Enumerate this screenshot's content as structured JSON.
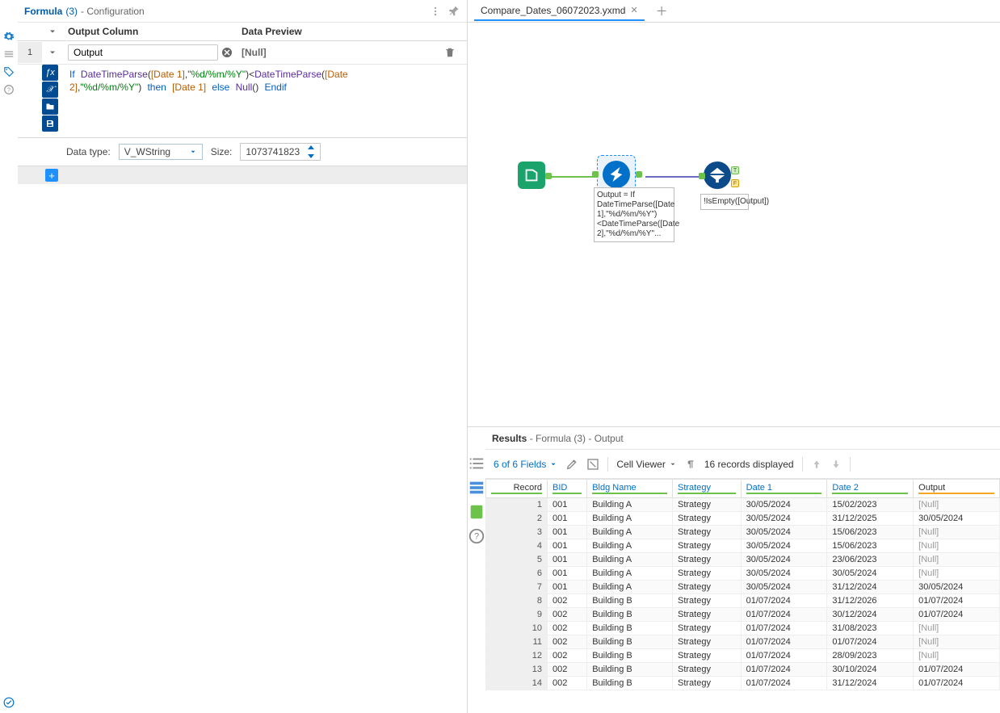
{
  "config": {
    "title": "Formula",
    "title_count": "(3)",
    "subtitle": "- Configuration",
    "header_output": "Output Column",
    "header_preview": "Data Preview",
    "row_index": "1",
    "output_field": "Output",
    "preview_value": "[Null]",
    "datatype_label": "Data type:",
    "datatype_value": "V_WString",
    "size_label": "Size:",
    "size_value": "1073741823",
    "formula_tokens": "If DateTimeParse([Date 1],\"%d/%m/%Y\")<DateTimeParse([Date 2],\"%d/%m/%Y\") then [Date 1] else Null() Endif"
  },
  "tab_name": "Compare_Dates_06072023.yxmd",
  "canvas": {
    "formula_label": "Output = If DateTimeParse([Date 1],\"%d/%m/%Y\")<DateTimeParse([Date 2],\"%d/%m/%Y\"...",
    "filter_label": "!IsEmpty([Output])"
  },
  "results": {
    "title": "Results",
    "subtitle": "- Formula (3) - Output",
    "fields_link": "6 of 6 Fields",
    "cellviewer": "Cell Viewer",
    "records_info": "16 records displayed",
    "columns": [
      "Record",
      "BID",
      "Bldg Name",
      "Strategy",
      "Date 1",
      "Date 2",
      "Output"
    ],
    "rows": [
      {
        "rec": "1",
        "bid": "001",
        "bldg": "Building A",
        "strat": "Strategy",
        "d1": "30/05/2024",
        "d2": "15/02/2023",
        "out": "[Null]"
      },
      {
        "rec": "2",
        "bid": "001",
        "bldg": "Building A",
        "strat": "Strategy",
        "d1": "30/05/2024",
        "d2": "31/12/2025",
        "out": "30/05/2024"
      },
      {
        "rec": "3",
        "bid": "001",
        "bldg": "Building A",
        "strat": "Strategy",
        "d1": "30/05/2024",
        "d2": "15/06/2023",
        "out": "[Null]"
      },
      {
        "rec": "4",
        "bid": "001",
        "bldg": "Building A",
        "strat": "Strategy",
        "d1": "30/05/2024",
        "d2": "15/06/2023",
        "out": "[Null]"
      },
      {
        "rec": "5",
        "bid": "001",
        "bldg": "Building A",
        "strat": "Strategy",
        "d1": "30/05/2024",
        "d2": "23/06/2023",
        "out": "[Null]"
      },
      {
        "rec": "6",
        "bid": "001",
        "bldg": "Building A",
        "strat": "Strategy",
        "d1": "30/05/2024",
        "d2": "30/05/2024",
        "out": "[Null]"
      },
      {
        "rec": "7",
        "bid": "001",
        "bldg": "Building A",
        "strat": "Strategy",
        "d1": "30/05/2024",
        "d2": "31/12/2024",
        "out": "30/05/2024"
      },
      {
        "rec": "8",
        "bid": "002",
        "bldg": "Building B",
        "strat": "Strategy",
        "d1": "01/07/2024",
        "d2": "31/12/2026",
        "out": "01/07/2024"
      },
      {
        "rec": "9",
        "bid": "002",
        "bldg": "Building B",
        "strat": "Strategy",
        "d1": "01/07/2024",
        "d2": "30/12/2024",
        "out": "01/07/2024"
      },
      {
        "rec": "10",
        "bid": "002",
        "bldg": "Building B",
        "strat": "Strategy",
        "d1": "01/07/2024",
        "d2": "31/08/2023",
        "out": "[Null]"
      },
      {
        "rec": "11",
        "bid": "002",
        "bldg": "Building B",
        "strat": "Strategy",
        "d1": "01/07/2024",
        "d2": "01/07/2024",
        "out": "[Null]"
      },
      {
        "rec": "12",
        "bid": "002",
        "bldg": "Building B",
        "strat": "Strategy",
        "d1": "01/07/2024",
        "d2": "28/09/2023",
        "out": "[Null]"
      },
      {
        "rec": "13",
        "bid": "002",
        "bldg": "Building B",
        "strat": "Strategy",
        "d1": "01/07/2024",
        "d2": "30/10/2024",
        "out": "01/07/2024"
      },
      {
        "rec": "14",
        "bid": "002",
        "bldg": "Building B",
        "strat": "Strategy",
        "d1": "01/07/2024",
        "d2": "31/12/2024",
        "out": "01/07/2024"
      }
    ]
  }
}
